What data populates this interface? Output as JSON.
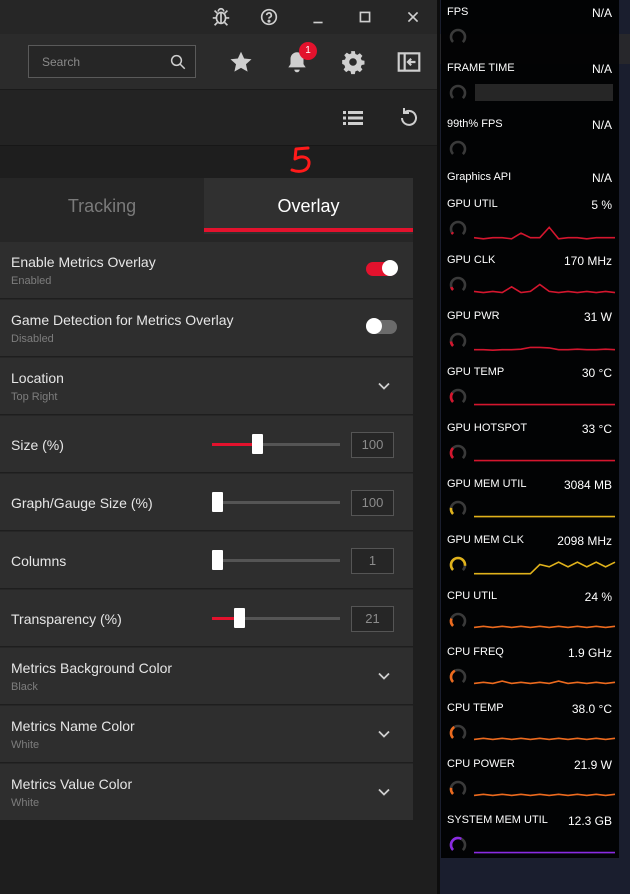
{
  "toolbar": {
    "search_placeholder": "Search",
    "notification_count": "1"
  },
  "annotation": {
    "mark": "5"
  },
  "tabs": [
    {
      "label": "Tracking",
      "active": false
    },
    {
      "label": "Overlay",
      "active": true
    }
  ],
  "settings": [
    {
      "label": "Enable Metrics Overlay",
      "sublabel": "Enabled",
      "control": "toggle",
      "on": true
    },
    {
      "label": "Game Detection for Metrics Overlay",
      "sublabel": "Disabled",
      "control": "toggle",
      "on": false
    },
    {
      "label": "Location",
      "sublabel": "Top Right",
      "control": "dropdown"
    },
    {
      "label": "Size (%)",
      "control": "slider",
      "value": "100",
      "fraction": 0.35
    },
    {
      "label": "Graph/Gauge Size (%)",
      "control": "slider",
      "value": "100",
      "fraction": 0.0
    },
    {
      "label": "Columns",
      "control": "slider",
      "value": "1",
      "fraction": 0.0
    },
    {
      "label": "Transparency (%)",
      "control": "slider",
      "value": "21",
      "fraction": 0.21
    },
    {
      "label": "Metrics Background Color",
      "sublabel": "Black",
      "control": "dropdown"
    },
    {
      "label": "Metrics Name Color",
      "sublabel": "White",
      "control": "dropdown"
    },
    {
      "label": "Metrics Value Color",
      "sublabel": "White",
      "control": "dropdown"
    }
  ],
  "metrics": [
    {
      "name": "FPS",
      "value": "N/A",
      "kind": "gauge"
    },
    {
      "name": "FRAME TIME",
      "value": "N/A",
      "kind": "box"
    },
    {
      "name": "99th% FPS",
      "value": "N/A",
      "kind": "gauge"
    },
    {
      "name": "Graphics API",
      "value": "N/A",
      "kind": "none"
    },
    {
      "name": "GPU UTIL",
      "value": "5 %",
      "kind": "graph",
      "color": "#d4162e",
      "level": 0.05,
      "spark": [
        0.9,
        0.95,
        0.9,
        0.9,
        0.95,
        0.7,
        0.9,
        0.9,
        0.45,
        0.95,
        0.9,
        0.9,
        0.95,
        0.9,
        0.9,
        0.9
      ]
    },
    {
      "name": "GPU CLK",
      "value": "170 MHz",
      "kind": "graph",
      "color": "#d4162e",
      "level": 0.1,
      "spark": [
        0.8,
        0.85,
        0.8,
        0.85,
        0.6,
        0.85,
        0.8,
        0.5,
        0.8,
        0.85,
        0.8,
        0.85,
        0.8,
        0.85,
        0.8,
        0.85
      ]
    },
    {
      "name": "GPU PWR",
      "value": "31 W",
      "kind": "graph",
      "color": "#d4162e",
      "level": 0.15,
      "spark": [
        0.9,
        0.9,
        0.92,
        0.9,
        0.9,
        0.88,
        0.8,
        0.8,
        0.82,
        0.9,
        0.9,
        0.88,
        0.9,
        0.9,
        0.88,
        0.9
      ]
    },
    {
      "name": "GPU TEMP",
      "value": "30 °C",
      "kind": "graph",
      "color": "#d4162e",
      "level": 0.3,
      "spark": [
        0.85,
        0.85,
        0.85,
        0.85,
        0.85,
        0.85,
        0.85,
        0.85,
        0.85,
        0.85,
        0.85,
        0.85,
        0.85,
        0.85,
        0.85,
        0.85
      ]
    },
    {
      "name": "GPU HOTSPOT",
      "value": "33 °C",
      "kind": "graph",
      "color": "#d4162e",
      "level": 0.33,
      "spark": [
        0.85,
        0.85,
        0.85,
        0.85,
        0.85,
        0.85,
        0.85,
        0.85,
        0.85,
        0.85,
        0.85,
        0.85,
        0.85,
        0.85,
        0.85,
        0.85
      ]
    },
    {
      "name": "GPU MEM UTIL",
      "value": "3084 MB",
      "kind": "graph",
      "color": "#e0b21b",
      "level": 0.2,
      "spark": [
        0.85,
        0.85,
        0.85,
        0.85,
        0.85,
        0.85,
        0.85,
        0.85,
        0.85,
        0.85,
        0.85,
        0.85,
        0.85,
        0.85,
        0.85,
        0.85
      ]
    },
    {
      "name": "GPU MEM CLK",
      "value": "2098 MHz",
      "kind": "graph",
      "color": "#e0b21b",
      "level": 0.85,
      "spark": [
        0.9,
        0.9,
        0.9,
        0.9,
        0.9,
        0.9,
        0.9,
        0.5,
        0.6,
        0.4,
        0.6,
        0.4,
        0.6,
        0.4,
        0.6,
        0.4
      ]
    },
    {
      "name": "CPU UTIL",
      "value": "24 %",
      "kind": "graph",
      "color": "#ec6a1e",
      "level": 0.24,
      "spark": [
        0.8,
        0.75,
        0.8,
        0.75,
        0.8,
        0.75,
        0.8,
        0.75,
        0.8,
        0.75,
        0.8,
        0.75,
        0.8,
        0.75,
        0.8,
        0.75
      ]
    },
    {
      "name": "CPU FREQ",
      "value": "1.9 GHz",
      "kind": "graph",
      "color": "#ec6a1e",
      "level": 0.4,
      "spark": [
        0.8,
        0.75,
        0.8,
        0.7,
        0.8,
        0.75,
        0.8,
        0.75,
        0.8,
        0.7,
        0.8,
        0.75,
        0.8,
        0.75,
        0.8,
        0.75
      ]
    },
    {
      "name": "CPU TEMP",
      "value": "38.0 °C",
      "kind": "graph",
      "color": "#ec6a1e",
      "level": 0.38,
      "spark": [
        0.8,
        0.75,
        0.8,
        0.75,
        0.8,
        0.75,
        0.8,
        0.75,
        0.8,
        0.75,
        0.8,
        0.75,
        0.8,
        0.75,
        0.8,
        0.75
      ]
    },
    {
      "name": "CPU POWER",
      "value": "21.9 W",
      "kind": "graph",
      "color": "#ec6a1e",
      "level": 0.2,
      "spark": [
        0.8,
        0.75,
        0.8,
        0.75,
        0.8,
        0.75,
        0.8,
        0.75,
        0.8,
        0.75,
        0.8,
        0.75,
        0.8,
        0.75,
        0.8,
        0.75
      ]
    },
    {
      "name": "SYSTEM MEM UTIL",
      "value": "12.3 GB",
      "kind": "graph",
      "color": "#8a2be2",
      "level": 0.6,
      "spark": [
        0.85,
        0.85,
        0.85,
        0.85,
        0.85,
        0.85,
        0.85,
        0.85,
        0.85,
        0.85,
        0.85,
        0.85,
        0.85,
        0.85,
        0.85,
        0.85
      ]
    }
  ],
  "colors": {
    "accent": "#e3122d"
  }
}
